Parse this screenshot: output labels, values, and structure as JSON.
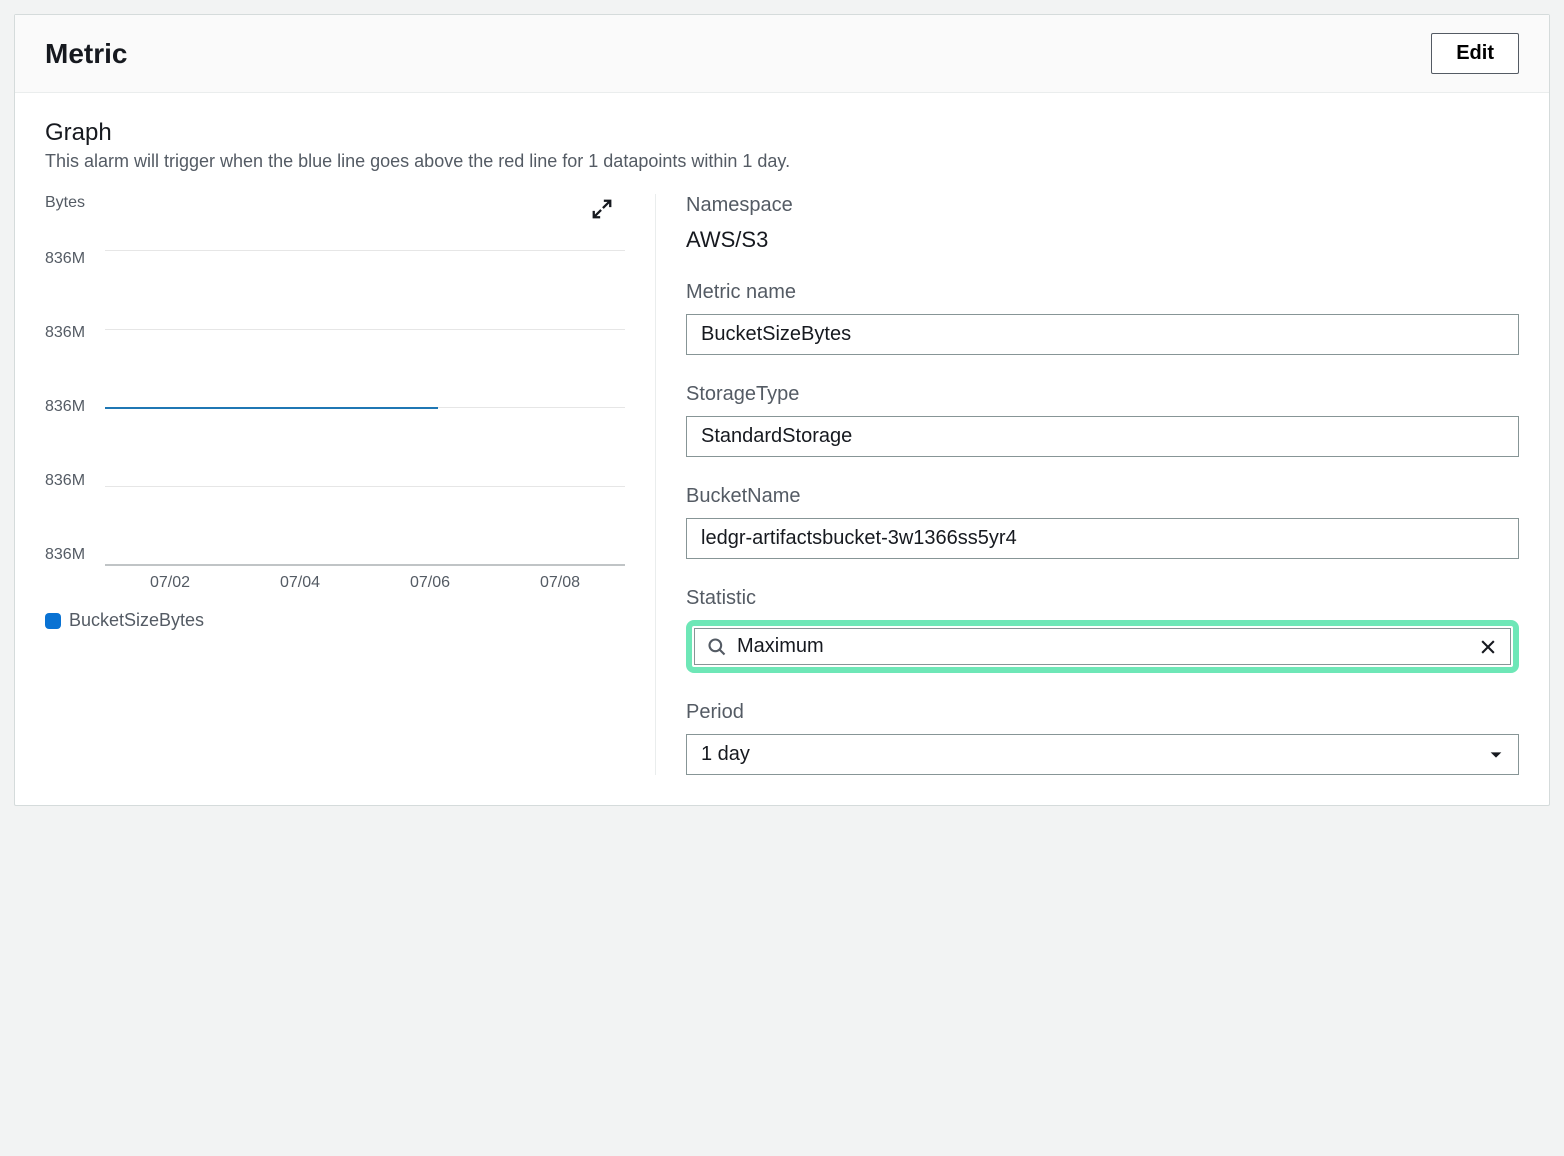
{
  "header": {
    "title": "Metric",
    "editBtn": "Edit"
  },
  "graph": {
    "title": "Graph",
    "description": "This alarm will trigger when the blue line goes above the red line for 1 datapoints within 1 day.",
    "ylabel": "Bytes",
    "legendLabel": "BucketSizeBytes"
  },
  "chart_data": {
    "type": "line",
    "title": "",
    "xlabel": "",
    "ylabel": "Bytes",
    "y_ticks": [
      "836M",
      "836M",
      "836M",
      "836M",
      "836M"
    ],
    "x_ticks": [
      "07/02",
      "07/04",
      "07/06",
      "07/08"
    ],
    "series": [
      {
        "name": "BucketSizeBytes",
        "x": [
          "07/01",
          "07/02",
          "07/03",
          "07/04",
          "07/05",
          "07/06"
        ],
        "values": [
          836,
          836,
          836,
          836,
          836,
          836
        ],
        "color": "#1f77b4"
      }
    ],
    "ylim_label": "836M"
  },
  "fields": {
    "namespaceLabel": "Namespace",
    "namespaceValue": "AWS/S3",
    "metricNameLabel": "Metric name",
    "metricNameValue": "BucketSizeBytes",
    "storageTypeLabel": "StorageType",
    "storageTypeValue": "StandardStorage",
    "bucketNameLabel": "BucketName",
    "bucketNameValue": "ledgr-artifactsbucket-3w1366ss5yr4",
    "statisticLabel": "Statistic",
    "statisticValue": "Maximum",
    "periodLabel": "Period",
    "periodValue": "1 day"
  }
}
